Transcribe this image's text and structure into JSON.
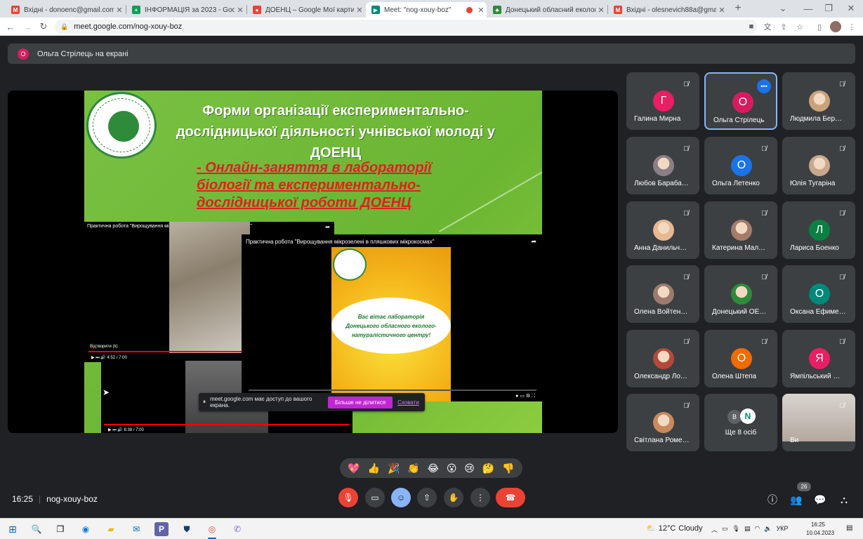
{
  "browser": {
    "tabs": [
      {
        "title": "Вхідні - donoenc@gmail.com - G",
        "icon": "gmail-icon",
        "color": "#ea4335"
      },
      {
        "title": "ІНФОРМАЦІЯ за 2023 - Google",
        "icon": "sheets-icon",
        "color": "#0f9d58"
      },
      {
        "title": "ДОЕНЦ – Google Мої карти",
        "icon": "maps-icon",
        "color": "#ea4335"
      },
      {
        "title": "Meet: \"nog-xouy-boz\"",
        "icon": "meet-icon",
        "color": "#00897b"
      },
      {
        "title": "Донецький обласний еколого-",
        "icon": "site-icon",
        "color": "#2e8b3a"
      },
      {
        "title": "Вхідні - olesnevich88a@gmail.co",
        "icon": "gmail-icon",
        "color": "#ea4335"
      }
    ],
    "url": "meet.google.com/nog-xouy-boz"
  },
  "presentation": {
    "presenter_initial": "О",
    "banner": "Ольга Стрілець на екрані"
  },
  "slide": {
    "title": "Форми організації експериментально-дослідницької діяльності учнівської молоді у ДОЕНЦ",
    "subtitle": "- Онлайн-заняття в лабораторії біології та експериментально-дослідницької роботи ДОЕНЦ",
    "video_title": "Практична робота \"Вирощування мікрозелені в пляшкових мікрокосмах\"",
    "video_welcome": "Вас вітає лабораторія Донецького обласного еколого-натуралістичного центру!",
    "video1_label": "Відтворити (k)",
    "video1_time": "4:52 / 7:00",
    "video3_time": "6:38 / 7:00"
  },
  "share_banner": {
    "text": "meet.google.com має доступ до вашого екрана.",
    "stop_label": "Більше не ділитися",
    "hide_label": "Сховати"
  },
  "participants": [
    {
      "name": "Галина Мирна",
      "initial": "Г",
      "color": "#e91e63"
    },
    {
      "name": "Ольга Стрілець",
      "initial": "О",
      "color": "#d81b60",
      "speaking": true
    },
    {
      "name": "Людмила Бер…",
      "photo": true,
      "color": "#c9a27a"
    },
    {
      "name": "Любов Бараба…",
      "photo": true,
      "color": "#8a7f86"
    },
    {
      "name": "Ольга Летенко",
      "initial": "О",
      "color": "#1a73e8"
    },
    {
      "name": "Юлія Тугаріна",
      "photo": true,
      "color": "#c8a98d"
    },
    {
      "name": "Анна Данильч…",
      "photo": true,
      "color": "#e8b890"
    },
    {
      "name": "Катерина Мал…",
      "photo": true,
      "color": "#a37c6a"
    },
    {
      "name": "Лариса Боенко",
      "initial": "Л",
      "color": "#0b8043"
    },
    {
      "name": "Олена Войтен…",
      "photo": true,
      "color": "#9c7b6e"
    },
    {
      "name": "Донецький ОЕ…",
      "photo": true,
      "color": "#2e8b3a"
    },
    {
      "name": "Оксана Ефиме…",
      "initial": "О",
      "color": "#00897b"
    },
    {
      "name": "Олександр Ло…",
      "photo": true,
      "color": "#b3493a"
    },
    {
      "name": "Олена Штепа",
      "initial": "О",
      "color": "#ef6c00"
    },
    {
      "name": "Ямпільський …",
      "initial": "Я",
      "color": "#e91e63"
    },
    {
      "name": "Світлана Роме…",
      "photo": true,
      "color": "#c98a5e"
    },
    {
      "name": "Ще 8 осіб",
      "others": true
    },
    {
      "name": "Ви",
      "self": true
    }
  ],
  "others_initials": [
    "В",
    "N"
  ],
  "reactions": [
    "💖",
    "👍",
    "🎉",
    "👏",
    "😂",
    "😮",
    "😢",
    "🤔",
    "👎"
  ],
  "meeting": {
    "time": "16:25",
    "code": "nog-xouy-boz",
    "participant_count": "26"
  },
  "taskbar": {
    "weather_temp": "12°C",
    "weather_desc": "Cloudy",
    "lang": "УКР",
    "clock_time": "16:25",
    "clock_date": "10.04.2023"
  }
}
